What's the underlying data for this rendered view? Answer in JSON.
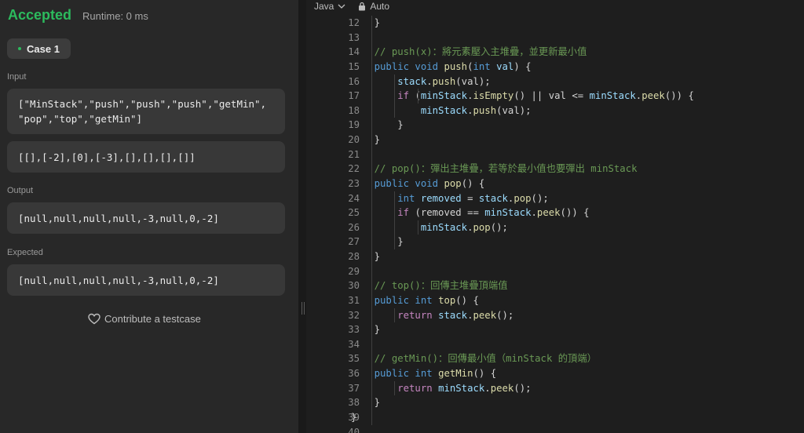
{
  "result": {
    "status": "Accepted",
    "runtime": "Runtime: 0 ms"
  },
  "testcase": {
    "tab_label": "Case 1"
  },
  "input": {
    "label": "Input",
    "ops_lines": [
      "[\"MinStack\",\"push\",\"push\",\"push\",\"getMin\",",
      "\"pop\",\"top\",\"getMin\"]"
    ],
    "args": "[[],[-2],[0],[-3],[],[],[],[]]"
  },
  "output": {
    "label": "Output",
    "value": "[null,null,null,null,-3,null,0,-2]"
  },
  "expected": {
    "label": "Expected",
    "value": "[null,null,null,null,-3,null,0,-2]"
  },
  "contribute_label": "Contribute a testcase",
  "editor": {
    "language": "Java",
    "format_mode": "Auto",
    "lines": [
      {
        "n": "12",
        "tokens": [
          [
            "pl",
            "    }"
          ]
        ]
      },
      {
        "n": "13",
        "tokens": []
      },
      {
        "n": "14",
        "tokens": [
          [
            "cm",
            "    // push(x)：將元素壓入主堆疊，並更新最小值"
          ]
        ]
      },
      {
        "n": "15",
        "tokens": [
          [
            "kw",
            "    public void "
          ],
          [
            "fn",
            "push"
          ],
          [
            "pl",
            "("
          ],
          [
            "kw",
            "int "
          ],
          [
            "var",
            "val"
          ],
          [
            "pl",
            ") {"
          ]
        ]
      },
      {
        "n": "16",
        "tokens": [
          [
            "var",
            "        stack"
          ],
          [
            "pl",
            "."
          ],
          [
            "fn",
            "push"
          ],
          [
            "pl",
            "(val);"
          ]
        ]
      },
      {
        "n": "17",
        "tokens": [
          [
            "ctl",
            "        if "
          ],
          [
            "pl",
            "("
          ],
          [
            "var",
            "minStack"
          ],
          [
            "pl",
            "."
          ],
          [
            "fn",
            "isEmpty"
          ],
          [
            "pl",
            "() || val <= "
          ],
          [
            "var",
            "minStack"
          ],
          [
            "pl",
            "."
          ],
          [
            "fn",
            "peek"
          ],
          [
            "pl",
            "()) {"
          ]
        ]
      },
      {
        "n": "18",
        "tokens": [
          [
            "var",
            "            minStack"
          ],
          [
            "pl",
            "."
          ],
          [
            "fn",
            "push"
          ],
          [
            "pl",
            "(val);"
          ]
        ]
      },
      {
        "n": "19",
        "tokens": [
          [
            "pl",
            "        }"
          ]
        ]
      },
      {
        "n": "20",
        "tokens": [
          [
            "pl",
            "    }"
          ]
        ]
      },
      {
        "n": "21",
        "tokens": []
      },
      {
        "n": "22",
        "tokens": [
          [
            "cm",
            "    // pop()：彈出主堆疊，若等於最小值也要彈出 minStack"
          ]
        ]
      },
      {
        "n": "23",
        "tokens": [
          [
            "kw",
            "    public void "
          ],
          [
            "fn",
            "pop"
          ],
          [
            "pl",
            "() {"
          ]
        ]
      },
      {
        "n": "24",
        "tokens": [
          [
            "kw",
            "        int "
          ],
          [
            "var",
            "removed"
          ],
          [
            "pl",
            " = "
          ],
          [
            "var",
            "stack"
          ],
          [
            "pl",
            "."
          ],
          [
            "fn",
            "pop"
          ],
          [
            "pl",
            "();"
          ]
        ]
      },
      {
        "n": "25",
        "tokens": [
          [
            "ctl",
            "        if "
          ],
          [
            "pl",
            "(removed == "
          ],
          [
            "var",
            "minStack"
          ],
          [
            "pl",
            "."
          ],
          [
            "fn",
            "peek"
          ],
          [
            "pl",
            "()) {"
          ]
        ]
      },
      {
        "n": "26",
        "tokens": [
          [
            "var",
            "            minStack"
          ],
          [
            "pl",
            "."
          ],
          [
            "fn",
            "pop"
          ],
          [
            "pl",
            "();"
          ]
        ]
      },
      {
        "n": "27",
        "tokens": [
          [
            "pl",
            "        }"
          ]
        ]
      },
      {
        "n": "28",
        "tokens": [
          [
            "pl",
            "    }"
          ]
        ]
      },
      {
        "n": "29",
        "tokens": []
      },
      {
        "n": "30",
        "tokens": [
          [
            "cm",
            "    // top()：回傳主堆疊頂端值"
          ]
        ]
      },
      {
        "n": "31",
        "tokens": [
          [
            "kw",
            "    public int "
          ],
          [
            "fn",
            "top"
          ],
          [
            "pl",
            "() {"
          ]
        ]
      },
      {
        "n": "32",
        "tokens": [
          [
            "ctl",
            "        return "
          ],
          [
            "var",
            "stack"
          ],
          [
            "pl",
            "."
          ],
          [
            "fn",
            "peek"
          ],
          [
            "pl",
            "();"
          ]
        ]
      },
      {
        "n": "33",
        "tokens": [
          [
            "pl",
            "    }"
          ]
        ]
      },
      {
        "n": "34",
        "tokens": []
      },
      {
        "n": "35",
        "tokens": [
          [
            "cm",
            "    // getMin()：回傳最小值（minStack 的頂端）"
          ]
        ]
      },
      {
        "n": "36",
        "tokens": [
          [
            "kw",
            "    public int "
          ],
          [
            "fn",
            "getMin"
          ],
          [
            "pl",
            "() {"
          ]
        ]
      },
      {
        "n": "37",
        "tokens": [
          [
            "ctl",
            "        return "
          ],
          [
            "var",
            "minStack"
          ],
          [
            "pl",
            "."
          ],
          [
            "fn",
            "peek"
          ],
          [
            "pl",
            "();"
          ]
        ]
      },
      {
        "n": "38",
        "tokens": [
          [
            "pl",
            "    }"
          ]
        ]
      },
      {
        "n": "39",
        "tokens": [
          [
            "pl",
            "}"
          ]
        ]
      },
      {
        "n": "40",
        "tokens": []
      }
    ]
  }
}
